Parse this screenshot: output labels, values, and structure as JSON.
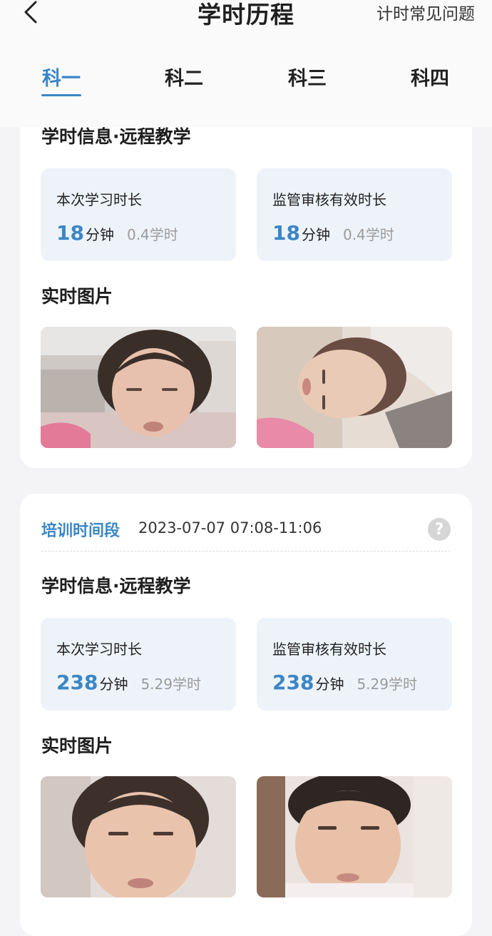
{
  "header": {
    "title": "学时历程",
    "faq_label": "计时常见问题"
  },
  "tabs": [
    {
      "label": "科一",
      "active": true
    },
    {
      "label": "科二",
      "active": false
    },
    {
      "label": "科三",
      "active": false
    },
    {
      "label": "科四",
      "active": false
    }
  ],
  "records": [
    {
      "info_title": "学时信息·远程教学",
      "study": {
        "label": "本次学习时长",
        "minutes": "18",
        "unit": "分钟",
        "hours": "0.4学时"
      },
      "verified": {
        "label": "监管审核有效时长",
        "minutes": "18",
        "unit": "分钟",
        "hours": "0.4学时"
      },
      "photos_title": "实时图片"
    },
    {
      "period_label": "培训时间段",
      "period_value": "2023-07-07 07:08-11:06",
      "info_title": "学时信息·远程教学",
      "study": {
        "label": "本次学习时长",
        "minutes": "238",
        "unit": "分钟",
        "hours": "5.29学时"
      },
      "verified": {
        "label": "监管审核有效时长",
        "minutes": "238",
        "unit": "分钟",
        "hours": "5.29学时"
      },
      "photos_title": "实时图片"
    }
  ],
  "icons": {
    "back": "chevron-left-icon",
    "help": "question-circle-icon"
  },
  "colors": {
    "accent": "#3b86c6",
    "stat_bg": "#eef3fa",
    "page_bg": "#f4f4f6"
  }
}
